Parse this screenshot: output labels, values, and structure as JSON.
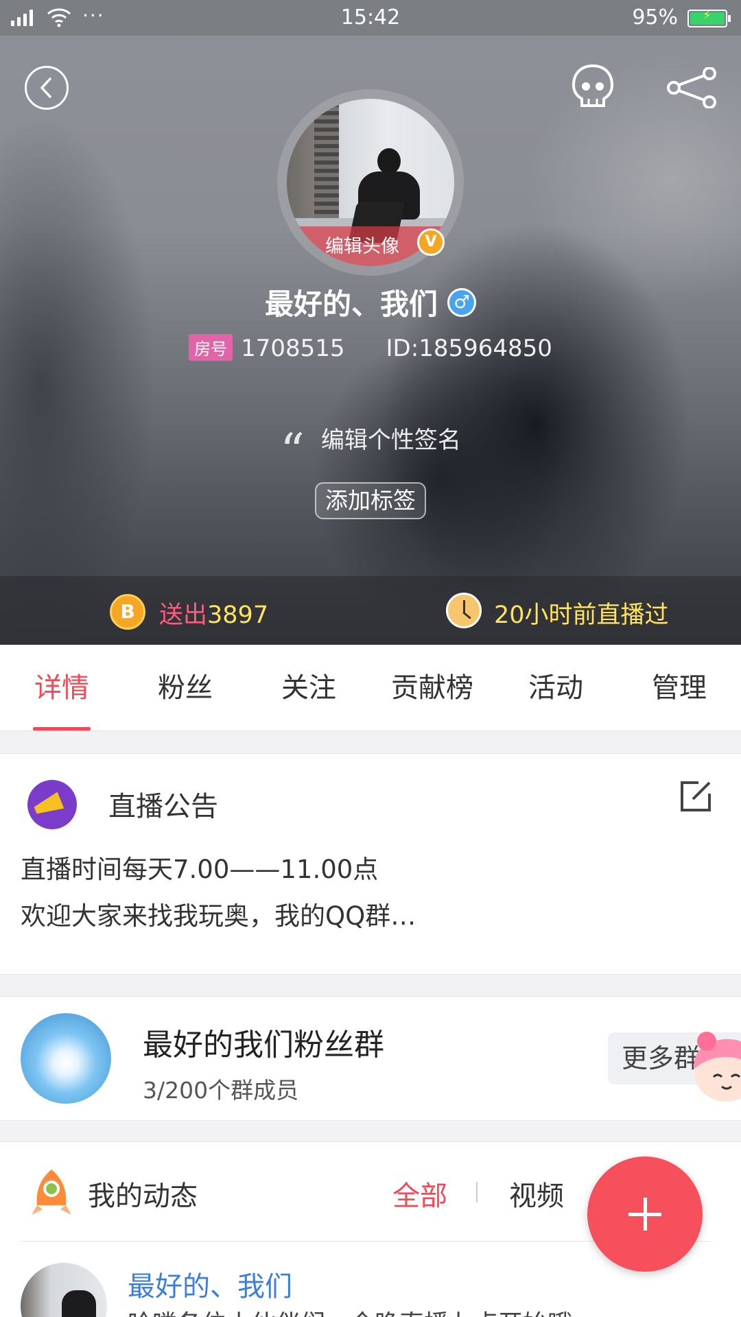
{
  "status_bar": {
    "time": "15:42",
    "battery_percent": "95%",
    "extra_indicator": "···"
  },
  "header": {
    "back_icon": "back-circle-icon",
    "skull_icon": "skull-icon",
    "share_icon": "share-icon",
    "avatar_edit_label": "编辑头像",
    "vip_badge": "V",
    "nickname": "最好的、我们",
    "gender_symbol": "♂",
    "room_tag": "房号",
    "room_number": "1708515",
    "user_id": "ID:185964850",
    "quote_mark": "“",
    "signature_placeholder": "编辑个性签名",
    "add_tag_label": "添加标签"
  },
  "stats": {
    "coin_symbol": "B",
    "sent_label": "送出",
    "sent_value": "3897",
    "last_live": "20小时前直播过"
  },
  "tabs": [
    {
      "label": "详情",
      "active": true
    },
    {
      "label": "粉丝",
      "active": false
    },
    {
      "label": "关注",
      "active": false
    },
    {
      "label": "贡献榜",
      "active": false
    },
    {
      "label": "活动",
      "active": false
    },
    {
      "label": "管理",
      "active": false
    }
  ],
  "notice": {
    "title": "直播公告",
    "line1": "直播时间每天7.00——11.00点",
    "line2": "欢迎大家来找我玩奥，我的QQ群…"
  },
  "fan_group": {
    "name": "最好的我们粉丝群",
    "member_count": "3/200个群成员",
    "more_label": "更多群"
  },
  "feed": {
    "title": "我的动态",
    "filter_all": "全部",
    "filter_video": "视频",
    "post_author": "最好的、我们",
    "post_preview": "哈喽各位小伙伴们，今晚直播九点开始哦"
  },
  "colors": {
    "accent_red": "#f04a56",
    "fab_red": "#f5505c",
    "gold": "#ffe45c",
    "pink": "#ff5b7c",
    "link_blue": "#3d7fd8"
  }
}
